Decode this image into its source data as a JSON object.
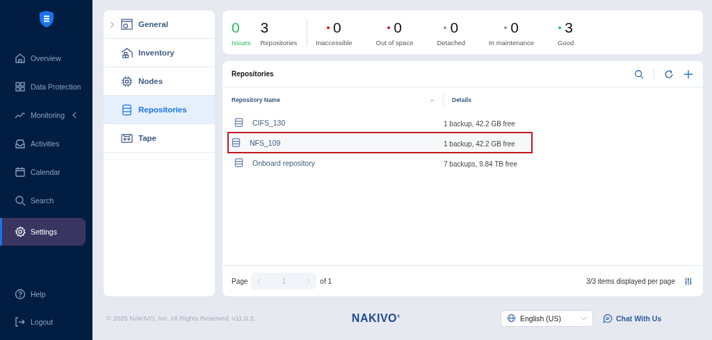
{
  "sidebar": {
    "items": [
      {
        "label": "Overview",
        "kind": "home",
        "selected": false
      },
      {
        "label": "Data Protection",
        "kind": "grid",
        "selected": false
      },
      {
        "label": "Monitoring",
        "kind": "chart",
        "selected": false,
        "expandable": true
      },
      {
        "label": "Activities",
        "kind": "inbox",
        "selected": false
      },
      {
        "label": "Calendar",
        "kind": "calendar",
        "selected": false
      },
      {
        "label": "Search",
        "kind": "search",
        "selected": false
      },
      {
        "label": "Settings",
        "kind": "gear",
        "selected": true
      }
    ],
    "bottom_items": [
      {
        "label": "Help",
        "kind": "help"
      },
      {
        "label": "Logout",
        "kind": "logout"
      }
    ]
  },
  "settings_menu": [
    {
      "label": "General",
      "kind": "general",
      "selected": false,
      "expandable": true
    },
    {
      "label": "Inventory",
      "kind": "inventory",
      "selected": false
    },
    {
      "label": "Nodes",
      "kind": "chip",
      "selected": false
    },
    {
      "label": "Repositories",
      "kind": "repo",
      "selected": true
    },
    {
      "label": "Tape",
      "kind": "tape",
      "selected": false
    }
  ],
  "summary": [
    {
      "kind": "issues",
      "value": "0",
      "label": "Issues"
    },
    {
      "kind": "total",
      "value": "3",
      "label": "Repositories"
    },
    {
      "kind": "status",
      "value": "0",
      "label": "Inaccessible",
      "color": "#d0111b"
    },
    {
      "kind": "status",
      "value": "0",
      "label": "Out of space",
      "color": "#d0111b"
    },
    {
      "kind": "status",
      "value": "0",
      "label": "Detached",
      "color": "#8196b4"
    },
    {
      "kind": "status",
      "value": "0",
      "label": "In maintenance",
      "color": "#8196b4"
    },
    {
      "kind": "status",
      "value": "3",
      "label": "Good",
      "color": "#1fbf5b"
    }
  ],
  "repositories": {
    "title": "Repositories",
    "columns": [
      "Repository Name",
      "Details"
    ],
    "rows": [
      {
        "name": "CIFS_130",
        "details": "1 backup, 42.2 GB free",
        "selected": false
      },
      {
        "name": "NFS_109",
        "details": "1 backup, 42.2 GB free",
        "selected": true
      },
      {
        "name": "Onboard repository",
        "details": "7 backups, 9.84 TB free",
        "selected": false
      }
    ],
    "pagination": {
      "label": "Page",
      "page": "1",
      "of": "of 1",
      "items": "3/3 items displayed per page"
    }
  },
  "footer": {
    "copyright": "© 2025 NAKIVO, Inc. All Rights Reserved. v11.0.3.",
    "logo": "NAKIVO$^{®}$",
    "language": "English (US)",
    "chat": "Chat With Us"
  }
}
